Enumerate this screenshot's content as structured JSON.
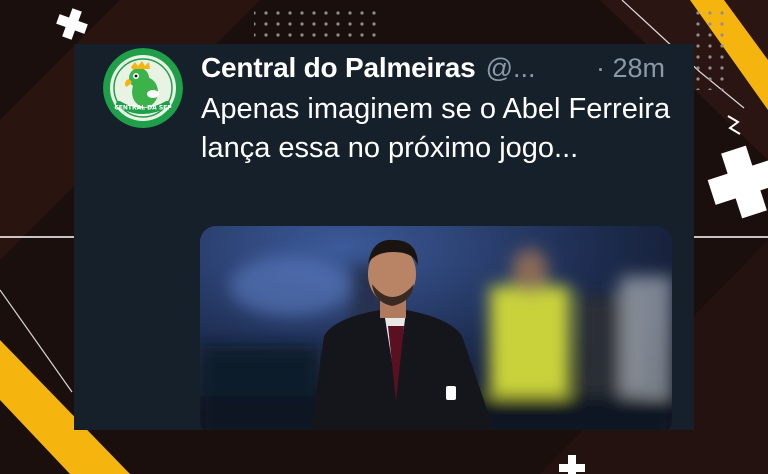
{
  "tweet": {
    "author_name": "Central do Palmeiras",
    "handle": "@...",
    "time": "· 28m",
    "text": "Apenas imaginem se o Abel Ferreira lança essa no próximo jogo..."
  },
  "avatar": {
    "caption": "CENTRAL DA SEP",
    "colors": {
      "ring": "#1f9f4a",
      "inner": "#e9f3e4",
      "parrot": "#3cb24b"
    }
  },
  "media": {
    "icon": "photo-of-coach-in-dark-suit",
    "colors": {
      "background": "#1b2b47",
      "vest": "#c9d23a",
      "suit": "#15161c"
    }
  },
  "background": {
    "icons": [
      "plus-icon",
      "dot-grid-icon",
      "diagonal-stripe"
    ],
    "colors": {
      "base": "#1a0f0d",
      "accent": "#f5b50e",
      "line": "#ffffff"
    }
  }
}
